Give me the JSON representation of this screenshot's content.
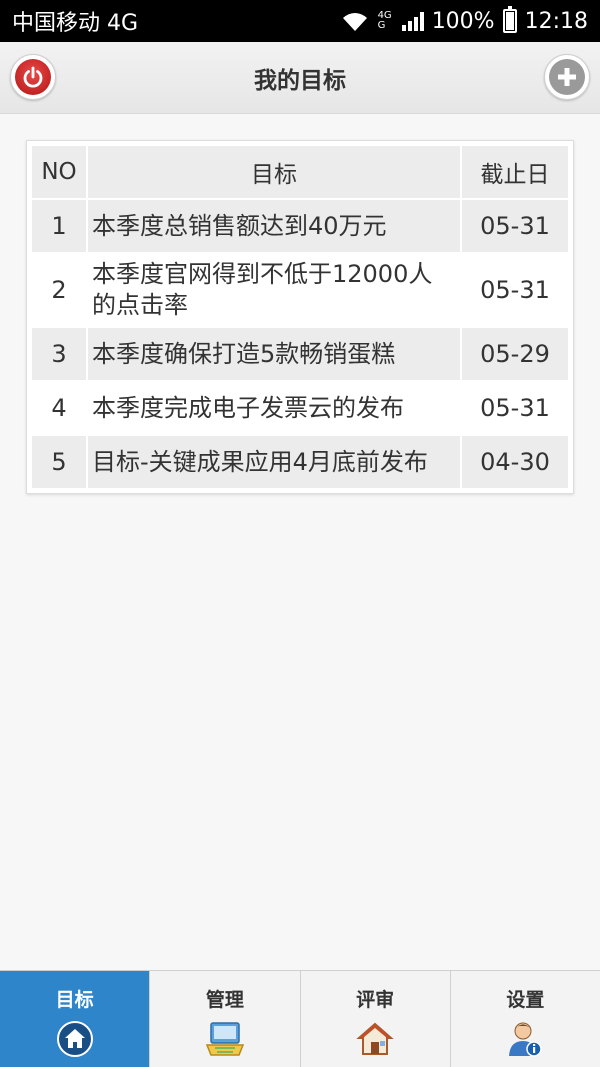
{
  "status": {
    "carrier": "中国移动 4G",
    "net_top": "4G",
    "net_bottom": "G",
    "battery": "100%",
    "time": "12:18"
  },
  "header": {
    "title": "我的目标"
  },
  "table": {
    "headers": {
      "no": "NO",
      "goal": "目标",
      "deadline": "截止日"
    },
    "rows": [
      {
        "no": "1",
        "goal": "本季度总销售额达到40万元",
        "deadline": "05-31"
      },
      {
        "no": "2",
        "goal": "本季度官网得到不低于12000人的点击率",
        "deadline": "05-31"
      },
      {
        "no": "3",
        "goal": "本季度确保打造5款畅销蛋糕",
        "deadline": "05-29"
      },
      {
        "no": "4",
        "goal": "本季度完成电子发票云的发布",
        "deadline": "05-31"
      },
      {
        "no": "5",
        "goal": "目标-关键成果应用4月底前发布",
        "deadline": "04-30"
      }
    ]
  },
  "tabs": [
    {
      "label": "目标",
      "icon": "home-icon",
      "active": true
    },
    {
      "label": "管理",
      "icon": "manage-icon",
      "active": false
    },
    {
      "label": "评审",
      "icon": "review-house-icon",
      "active": false
    },
    {
      "label": "设置",
      "icon": "user-settings-icon",
      "active": false
    }
  ],
  "colors": {
    "active_tab": "#2f85c9",
    "power_red": "#c62020",
    "header_bg": "#ececec"
  }
}
